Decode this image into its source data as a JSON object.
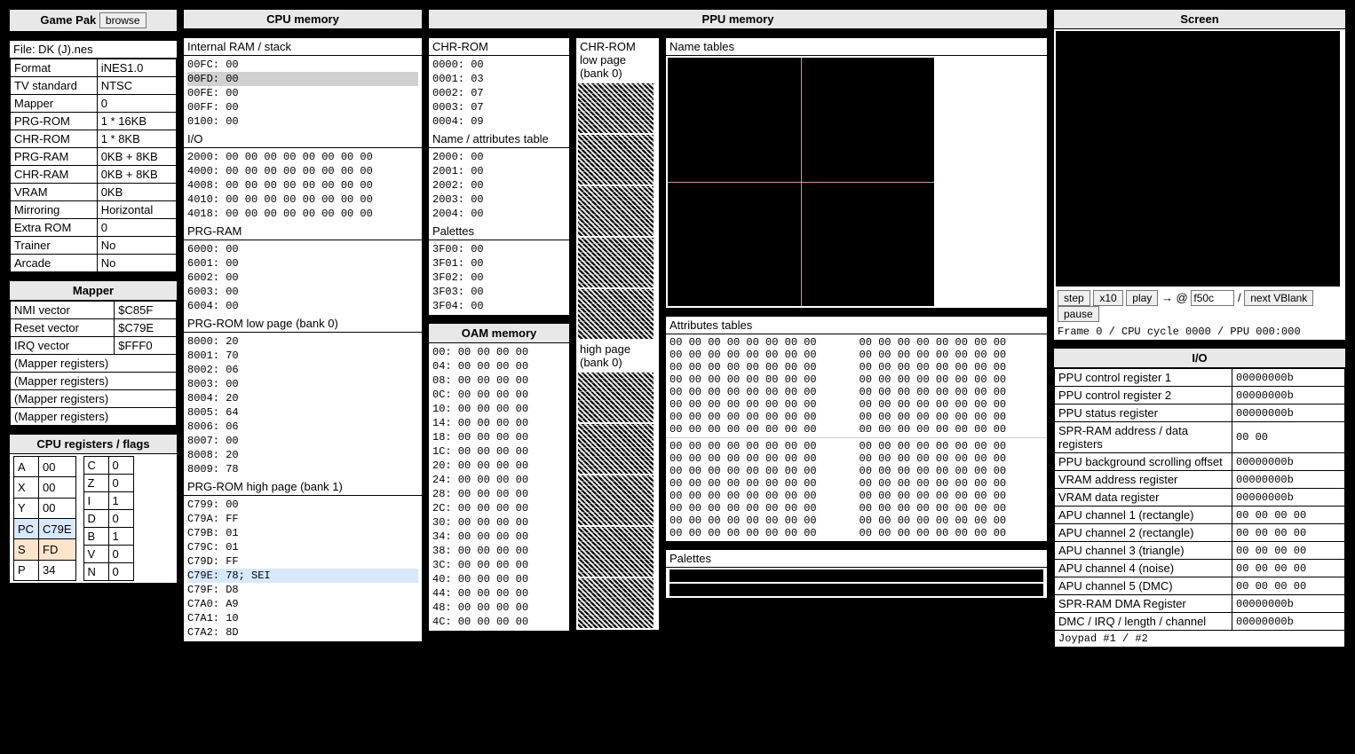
{
  "headers": {
    "gamepak": "Game Pak",
    "browse": "browse",
    "cpumem": "CPU memory",
    "ppumem": "PPU memory",
    "screen": "Screen",
    "oam": "OAM memory",
    "io": "I/O",
    "mapper": "Mapper",
    "cpuregs": "CPU registers / flags"
  },
  "file_label": "File: DK (J).nes",
  "gamepak": [
    [
      "Format",
      "iNES1.0"
    ],
    [
      "TV standard",
      "NTSC"
    ],
    [
      "Mapper",
      "0"
    ],
    [
      "PRG-ROM",
      "1 * 16KB"
    ],
    [
      "CHR-ROM",
      "1 * 8KB"
    ],
    [
      "PRG-RAM",
      "0KB + 8KB"
    ],
    [
      "CHR-RAM",
      "0KB + 8KB"
    ],
    [
      "VRAM",
      "0KB"
    ],
    [
      "Mirroring",
      "Horizontal"
    ],
    [
      "Extra ROM",
      "0"
    ],
    [
      "Trainer",
      "No"
    ],
    [
      "Arcade",
      "No"
    ]
  ],
  "mapper_rows": [
    [
      "NMI vector",
      "$C85F"
    ],
    [
      "Reset vector",
      "$C79E"
    ],
    [
      "IRQ vector",
      "$FFF0"
    ],
    [
      "(Mapper registers)",
      ""
    ],
    [
      "(Mapper registers)",
      ""
    ],
    [
      "(Mapper registers)",
      ""
    ],
    [
      "(Mapper registers)",
      ""
    ]
  ],
  "cpu_regs_a": [
    [
      "A",
      "00",
      ""
    ],
    [
      "X",
      "00",
      ""
    ],
    [
      "Y",
      "00",
      ""
    ],
    [
      "PC",
      "C79E",
      "hl-blue"
    ],
    [
      "S",
      "FD",
      "hl-peach"
    ],
    [
      "P",
      "34",
      ""
    ]
  ],
  "cpu_flags": [
    [
      "C",
      "0"
    ],
    [
      "Z",
      "0"
    ],
    [
      "I",
      "1"
    ],
    [
      "D",
      "0"
    ],
    [
      "B",
      "1"
    ],
    [
      "V",
      "0"
    ],
    [
      "N",
      "0"
    ]
  ],
  "cpu_mem": {
    "ram_label": "Internal RAM / stack",
    "ram": [
      {
        "t": "00FC: 00"
      },
      {
        "t": "00FD: 00",
        "cls": "hl-gray"
      },
      {
        "t": "00FE: 00"
      },
      {
        "t": "00FF: 00"
      },
      {
        "t": "0100: 00"
      }
    ],
    "io_label": "I/O",
    "io": [
      "2000: 00 00 00 00 00 00 00 00",
      "4000: 00 00 00 00 00 00 00 00",
      "4008: 00 00 00 00 00 00 00 00",
      "4010: 00 00 00 00 00 00 00 00",
      "4018: 00 00 00 00 00 00 00 00"
    ],
    "prgram_label": "PRG-RAM",
    "prgram": [
      "6000: 00",
      "6001: 00",
      "6002: 00",
      "6003: 00",
      "6004: 00"
    ],
    "prglo_label": "PRG-ROM low page (bank 0)",
    "prglo": [
      "8000: 20",
      "8001: 70",
      "8002: 06",
      "8003: 00",
      "8004: 20",
      "8005: 64",
      "8006: 06",
      "8007: 00",
      "8008: 20",
      "8009: 78"
    ],
    "prghi_label": "PRG-ROM high page (bank 1)",
    "prghi": [
      {
        "t": "C799: 00"
      },
      {
        "t": "C79A: FF"
      },
      {
        "t": "C79B: 01"
      },
      {
        "t": "C79C: 01"
      },
      {
        "t": "C79D: FF"
      },
      {
        "t": "C79E: 78; SEI",
        "cls": "hl-blue"
      },
      {
        "t": "C79F: D8"
      },
      {
        "t": "C7A0: A9"
      },
      {
        "t": "C7A1: 10"
      },
      {
        "t": "C7A2: 8D"
      }
    ]
  },
  "ppu_mem": {
    "chr_label": "CHR-ROM",
    "chr": [
      "0000: 00",
      "0001: 03",
      "0002: 07",
      "0003: 07",
      "0004: 09"
    ],
    "nt_label": "Name / attributes table",
    "nt": [
      "2000: 00",
      "2001: 00",
      "2002: 00",
      "2003: 00",
      "2004: 00"
    ],
    "pal_label": "Palettes",
    "pal": [
      "3F00: 00",
      "3F01: 00",
      "3F02: 00",
      "3F03: 00",
      "3F04: 00"
    ]
  },
  "tile_labels": {
    "low": "CHR-ROM\nlow page\n(bank 0)",
    "high": "high page\n(bank 0)"
  },
  "oam": [
    "00: 00 00 00 00",
    "04: 00 00 00 00",
    "08: 00 00 00 00",
    "0C: 00 00 00 00",
    "10: 00 00 00 00",
    "14: 00 00 00 00",
    "18: 00 00 00 00",
    "1C: 00 00 00 00",
    "20: 00 00 00 00",
    "24: 00 00 00 00",
    "28: 00 00 00 00",
    "2C: 00 00 00 00",
    "30: 00 00 00 00",
    "34: 00 00 00 00",
    "38: 00 00 00 00",
    "3C: 00 00 00 00",
    "40: 00 00 00 00",
    "44: 00 00 00 00",
    "48: 00 00 00 00",
    "4C: 00 00 00 00"
  ],
  "name_tables_label": "Name tables",
  "attr_tables_label": "Attributes tables",
  "attr_line": "00 00 00 00 00 00 00 00",
  "palettes_label": "Palettes",
  "screen_controls": {
    "step": "step",
    "x10": "x10",
    "play": "play",
    "arrow": "→ @",
    "target": "f50c",
    "slash": "/",
    "next": "next VBlank",
    "pause": "pause"
  },
  "status_line": "Frame 0 / CPU cycle 0000 / PPU 000:000",
  "io_rows": [
    [
      "PPU control register 1",
      "00000000b"
    ],
    [
      "PPU control register 2",
      "00000000b"
    ],
    [
      "PPU status register",
      "00000000b"
    ],
    [
      "SPR-RAM address / data registers",
      "00 00"
    ],
    [
      "PPU background scrolling offset",
      "00000000b"
    ],
    [
      "VRAM address register",
      "00000000b"
    ],
    [
      "VRAM data register",
      "00000000b"
    ],
    [
      "APU channel 1 (rectangle)",
      "00 00 00 00"
    ],
    [
      "APU channel 2 (rectangle)",
      "00 00 00 00"
    ],
    [
      "APU channel 3 (triangle)",
      "00 00 00 00"
    ],
    [
      "APU channel 4 (noise)",
      "00 00 00 00"
    ],
    [
      "APU channel 5 (DMC)",
      "00 00 00 00"
    ],
    [
      "SPR-RAM DMA Register",
      "00000000b"
    ],
    [
      "DMC / IRQ / length / channel",
      "00000000b"
    ],
    [
      "Joypad #1 / #2",
      ""
    ]
  ]
}
